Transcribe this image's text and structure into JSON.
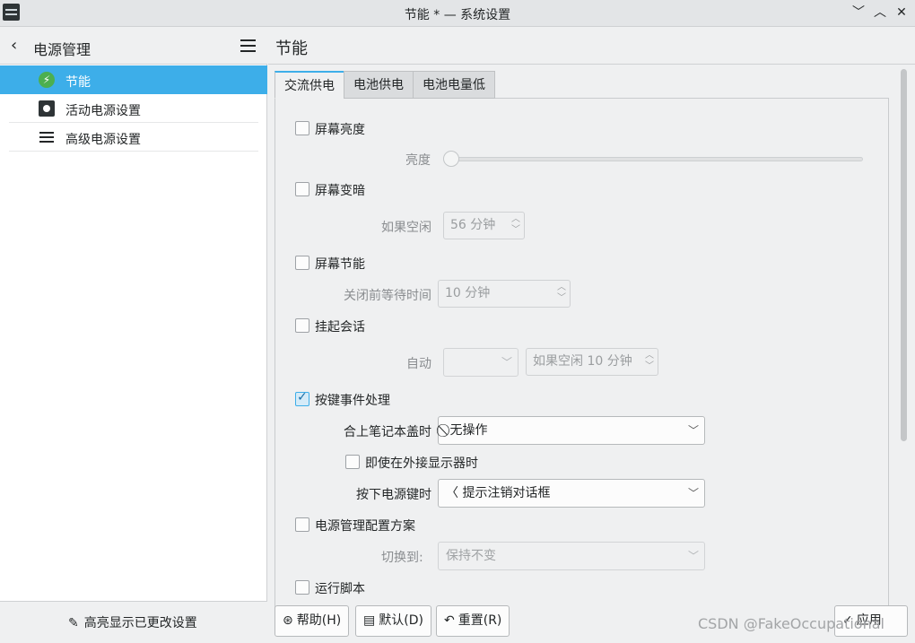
{
  "window": {
    "title": "节能 * — 系统设置",
    "minimize": "﹀",
    "maximize": "︿",
    "close": "✕"
  },
  "sidebar": {
    "title": "电源管理",
    "items": [
      {
        "label": "节能",
        "icon": "energy-saving-icon",
        "selected": true
      },
      {
        "label": "活动电源设置",
        "icon": "activity-icon",
        "selected": false
      },
      {
        "label": "高级电源设置",
        "icon": "list-icon",
        "selected": false
      }
    ],
    "footer_label": "高亮显示已更改设置"
  },
  "main": {
    "page_title": "节能",
    "tabs": [
      {
        "label": "交流供电",
        "active": true
      },
      {
        "label": "电池供电",
        "active": false
      },
      {
        "label": "电池电量低",
        "active": false
      }
    ],
    "screen_brightness": {
      "label": "屏幕亮度",
      "checked": false,
      "sub_label": "亮度",
      "level": 0
    },
    "dim_screen": {
      "label": "屏幕变暗",
      "checked": false,
      "sub_label": "如果空闲",
      "value": "56 分钟"
    },
    "screen_energy": {
      "label": "屏幕节能",
      "checked": false,
      "sub_label": "关闭前等待时间",
      "value": "10 分钟"
    },
    "suspend": {
      "label": "挂起会话",
      "checked": false,
      "sub_label": "自动",
      "value": "",
      "idle_value": "如果空闲 10 分钟"
    },
    "button_events": {
      "label": "按键事件处理",
      "checked": true,
      "lid_label": "合上笔记本盖时",
      "lid_value": "⃠ 无操作",
      "external_label": "即使在外接显示器时",
      "external_checked": false,
      "power_label": "按下电源键时",
      "power_value": "〈 提示注销对话框"
    },
    "profile": {
      "label": "电源管理配置方案",
      "checked": false,
      "sub_label": "切换到:",
      "value": "保持不变"
    },
    "script": {
      "label": "运行脚本",
      "checked": false
    }
  },
  "buttons": {
    "help": "帮助(H)",
    "defaults": "默认(D)",
    "reset": "重置(R)",
    "apply": "应用(A)"
  },
  "watermark": "CSDN @FakeOccupational",
  "accent_color": "#3daee9"
}
